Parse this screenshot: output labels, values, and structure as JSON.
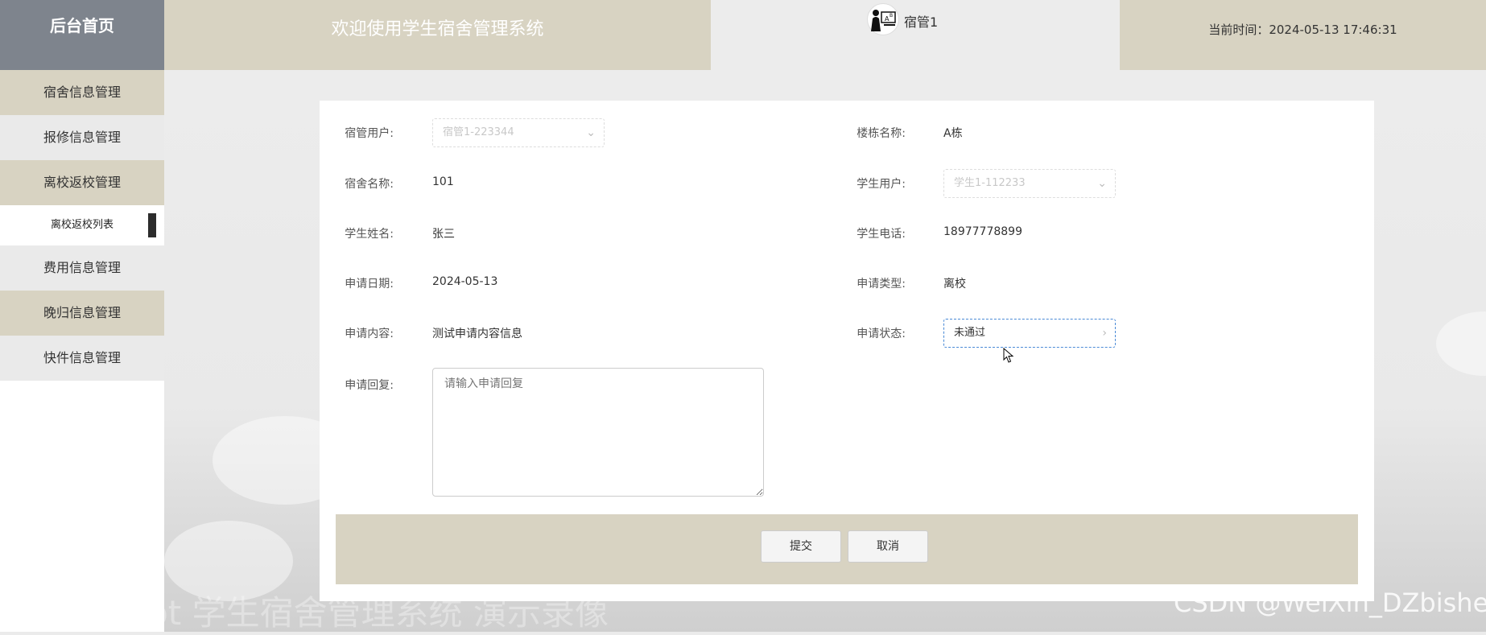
{
  "header": {
    "brand": "后台首页",
    "welcome": "欢迎使用学生宿舍管理系统",
    "username": "宿管1",
    "time_label": "当前时间：2024-05-13 17:46:31"
  },
  "sidebar": {
    "items": [
      {
        "label": "宿舍信息管理"
      },
      {
        "label": "报修信息管理"
      },
      {
        "label": "离校返校管理"
      },
      {
        "label": "离校返校列表"
      },
      {
        "label": "费用信息管理"
      },
      {
        "label": "晚归信息管理"
      },
      {
        "label": "快件信息管理"
      }
    ]
  },
  "form": {
    "manager_user": {
      "label": "宿管用户:",
      "value": "宿管1-223344"
    },
    "building_name": {
      "label": "楼栋名称:",
      "value": "A栋"
    },
    "dorm_name": {
      "label": "宿舍名称:",
      "value": "101"
    },
    "student_user": {
      "label": "学生用户:",
      "value": "学生1-112233"
    },
    "student_name": {
      "label": "学生姓名:",
      "value": "张三"
    },
    "student_phone": {
      "label": "学生电话:",
      "value": "18977778899"
    },
    "apply_date": {
      "label": "申请日期:",
      "value": "2024-05-13"
    },
    "apply_type": {
      "label": "申请类型:",
      "value": "离校"
    },
    "apply_content": {
      "label": "申请内容:",
      "value": "测试申请内容信息"
    },
    "apply_status": {
      "label": "申请状态:",
      "value": "未通过"
    },
    "apply_reply": {
      "label": "申请回复:",
      "placeholder": "请输入申请回复"
    }
  },
  "buttons": {
    "submit": "提交",
    "cancel": "取消"
  },
  "watermarks": {
    "left": "springboot 学生宿舍管理系统 演示录像",
    "right": "CSDN @WeiXin_DZbishe"
  }
}
